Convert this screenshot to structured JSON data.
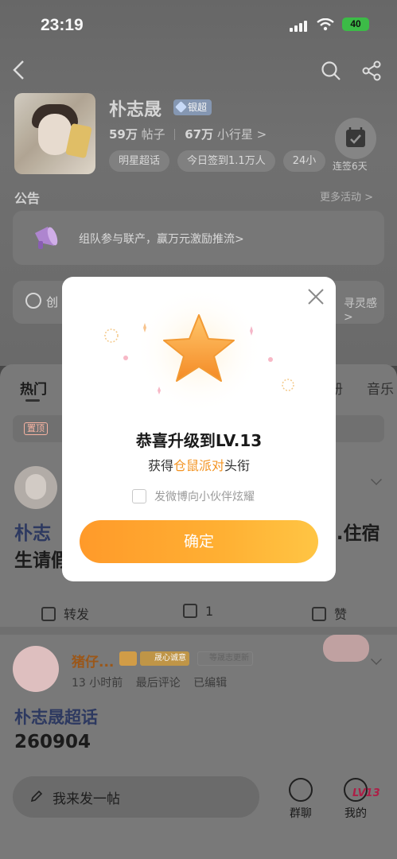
{
  "status_bar": {
    "time": "23:19",
    "battery": "40"
  },
  "profile": {
    "name": "朴志晟",
    "badge": "银超",
    "posts_count": "59万",
    "posts_label": "帖子",
    "fans_count": "67万",
    "fans_label": "小行星 >",
    "chips": [
      "明星超话",
      "今日签到1.1万人",
      "24小"
    ],
    "checkin_label": "连签6天"
  },
  "notice": {
    "title": "公告",
    "more": "更多活动 >",
    "text": "组队参与联产，赢万元激励推流>"
  },
  "create_row": {
    "label": "创",
    "right": "寻灵感 >"
  },
  "tabs": [
    {
      "label": "热门"
    },
    {
      "label": "册"
    },
    {
      "label": "音乐"
    }
  ],
  "pinned": {
    "tag": "置顶"
  },
  "post1": {
    "topic": "朴志",
    "text_line1_end": "..住宿",
    "text_line2": "生请假",
    "forward_label": "转发",
    "comment_count": "1",
    "like_label": "赞"
  },
  "post2": {
    "user": "猪仔...",
    "level_tag": "晟心诚意",
    "extra_tag": "等晟志更新",
    "time": "13 小时前",
    "meta_last": "最后评论",
    "meta_edit": "已编辑",
    "topic": "朴志晟超话",
    "body": "260904"
  },
  "bottom_bar": {
    "compose_label": "我来发一帖",
    "group_chat": "群聊",
    "mine": "我的",
    "mine_badge": "LV13"
  },
  "modal": {
    "title": "恭喜升级到LV.13",
    "sub_prefix": "获得",
    "sub_highlight": "仓鼠派对",
    "sub_suffix": "头衔",
    "share_checkbox_label": "发微博向小伙伴炫耀",
    "confirm": "确定",
    "star_color": "#f7a23b",
    "accent": "#ff9a2a"
  }
}
